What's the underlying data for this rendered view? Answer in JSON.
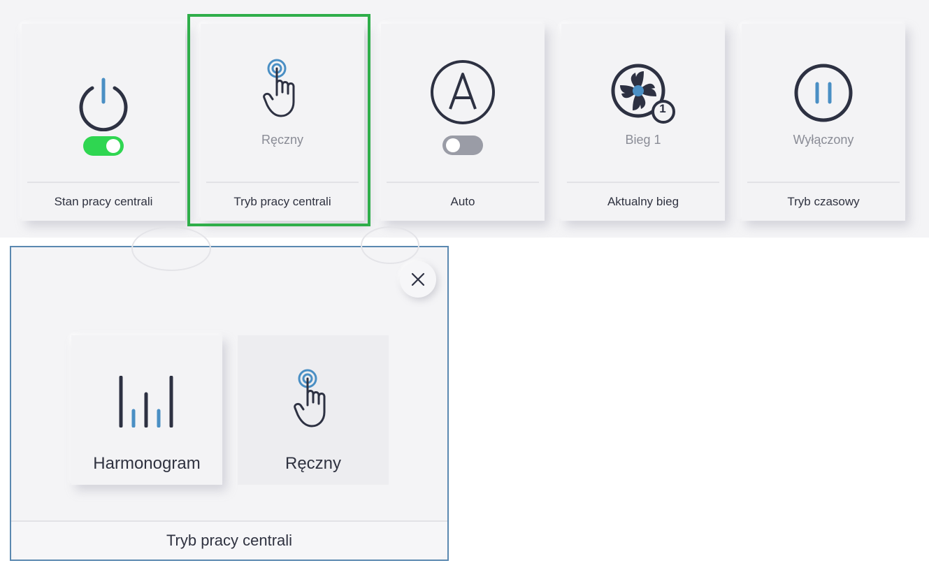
{
  "colors": {
    "accent_blue": "#4a8fc4",
    "icon_dark": "#2d3142",
    "toggle_on": "#2fd651",
    "toggle_off": "#9a9ca6",
    "highlight": "#2fae4a"
  },
  "tiles": [
    {
      "icon": "power-icon",
      "toggle": "on",
      "footer": "Stan pracy centrali"
    },
    {
      "icon": "hand-pointer-icon",
      "status": "Ręczny",
      "footer": "Tryb pracy centrali"
    },
    {
      "icon": "auto-a-icon",
      "toggle": "off",
      "footer": "Auto"
    },
    {
      "icon": "fan-icon",
      "badge": "1",
      "status": "Bieg 1",
      "footer": "Aktualny bieg"
    },
    {
      "icon": "pause-icon",
      "status": "Wyłączony",
      "footer": "Tryb czasowy"
    }
  ],
  "modal": {
    "close_icon": "close-icon",
    "options": [
      {
        "icon": "schedule-bars-icon",
        "label": "Harmonogram"
      },
      {
        "icon": "hand-pointer-icon",
        "label": "Ręczny"
      }
    ],
    "footer": "Tryb pracy centrali"
  }
}
